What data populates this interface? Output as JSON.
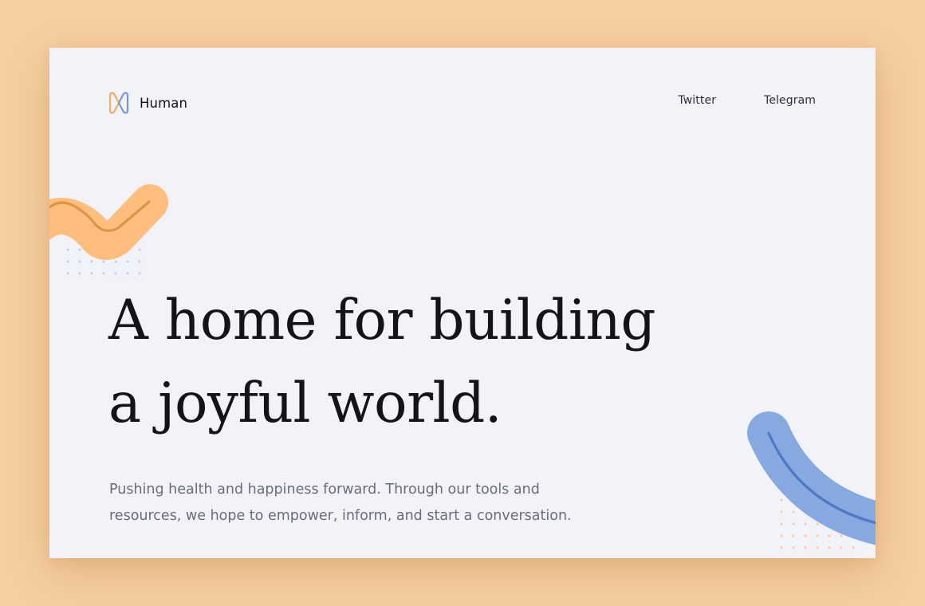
{
  "brand": {
    "name": "Human",
    "logo_icon": "human-logo-icon"
  },
  "nav": {
    "items": [
      {
        "label": "Twitter"
      },
      {
        "label": "Telegram"
      }
    ]
  },
  "hero": {
    "headline_line1": "A home for building",
    "headline_line2": "a joyful world.",
    "subtext_line1": "Pushing health and happiness forward. Through our tools and",
    "subtext_line2": "resources, we hope to empower, inform, and start a conversation."
  },
  "colors": {
    "outer_background": "#f6cea0",
    "page_background": "#f2f3f9",
    "accent_orange": "#ffbe7e",
    "accent_orange_dark": "#dd9448",
    "accent_blue": "#88a9e0",
    "accent_blue_dark": "#4f78c4",
    "dots_lavender": "#c4c7ea",
    "dots_peach": "#ffc595",
    "heading_text": "#141418",
    "body_text": "#6b6c75"
  }
}
